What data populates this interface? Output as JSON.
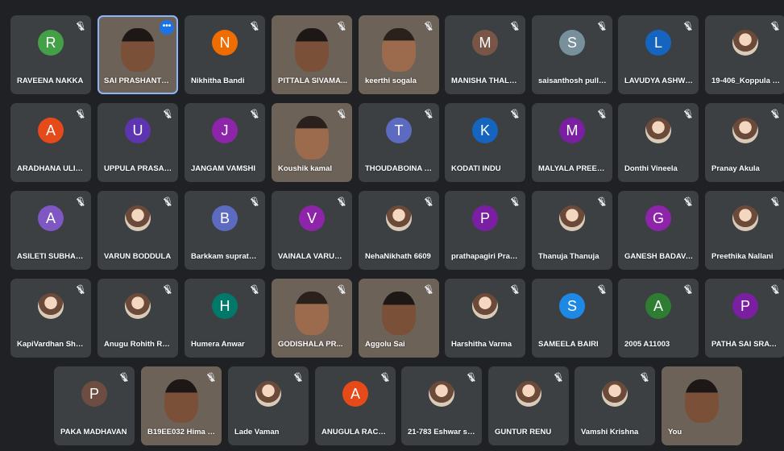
{
  "participants": [
    {
      "name": "RAVEENA NAKKA",
      "avatar": "letter",
      "initial": "R",
      "color": "#43a047",
      "muted": true
    },
    {
      "name": "SAI PRASHANTH ...",
      "avatar": "video",
      "video": "vid-a",
      "muted": false,
      "active": true
    },
    {
      "name": "Nikhitha Bandi",
      "avatar": "letter",
      "initial": "N",
      "color": "#ef6c00",
      "muted": true
    },
    {
      "name": "PITTALA SIVAMA...",
      "avatar": "video",
      "video": "vid-b",
      "muted": true
    },
    {
      "name": "keerthi sogala",
      "avatar": "video",
      "video": "vid-c",
      "muted": true
    },
    {
      "name": "MANISHA THALLA...",
      "avatar": "letter",
      "initial": "M",
      "color": "#795548",
      "muted": true
    },
    {
      "name": "saisanthosh pulluri",
      "avatar": "letter",
      "initial": "S",
      "color": "#78909c",
      "muted": true
    },
    {
      "name": "LAVUDYA ASHWINI",
      "avatar": "letter",
      "initial": "L",
      "color": "#1565c0",
      "muted": true
    },
    {
      "name": "19-406_Koppula S...",
      "avatar": "photo",
      "muted": true
    },
    {
      "name": "ARADHANA ULIRA...",
      "avatar": "letter",
      "initial": "A",
      "color": "#e64a19",
      "muted": true
    },
    {
      "name": "UPPULA PRASAN...",
      "avatar": "letter",
      "initial": "U",
      "color": "#5e35b1",
      "muted": true
    },
    {
      "name": "JANGAM VAMSHI",
      "avatar": "letter",
      "initial": "J",
      "color": "#8e24aa",
      "muted": true
    },
    {
      "name": "Koushik kamal",
      "avatar": "video",
      "video": "vid-d",
      "muted": true
    },
    {
      "name": "THOUDABOINA S...",
      "avatar": "letter",
      "initial": "T",
      "color": "#5c6bc0",
      "muted": true
    },
    {
      "name": "KODATI INDU",
      "avatar": "letter",
      "initial": "K",
      "color": "#1565c0",
      "muted": true
    },
    {
      "name": "MALYALA PREETH...",
      "avatar": "letter",
      "initial": "M",
      "color": "#7b1fa2",
      "muted": true
    },
    {
      "name": "Donthi Vineela",
      "avatar": "photo",
      "muted": true
    },
    {
      "name": "Pranay Akula",
      "avatar": "photo",
      "muted": true
    },
    {
      "name": "ASILETI SUBHASH",
      "avatar": "letter",
      "initial": "A",
      "color": "#7e57c2",
      "muted": true
    },
    {
      "name": "VARUN BODDULA",
      "avatar": "photo",
      "muted": true
    },
    {
      "name": "Barkkam suprathika",
      "avatar": "letter",
      "initial": "B",
      "color": "#5c6bc0",
      "muted": true
    },
    {
      "name": "VAINALA VARUN T...",
      "avatar": "letter",
      "initial": "V",
      "color": "#8e24aa",
      "muted": true
    },
    {
      "name": "NehaNikhath 6609",
      "avatar": "photo",
      "muted": true
    },
    {
      "name": "prathapagiri Prag...",
      "avatar": "letter",
      "initial": "P",
      "color": "#7b1fa2",
      "muted": true
    },
    {
      "name": "Thanuja Thanuja",
      "avatar": "photo",
      "muted": true
    },
    {
      "name": "GANESH BADAVA...",
      "avatar": "letter",
      "initial": "G",
      "color": "#8e24aa",
      "muted": true
    },
    {
      "name": "Preethika Nallani",
      "avatar": "photo",
      "muted": true
    },
    {
      "name": "KapiVardhan Shar...",
      "avatar": "photo",
      "muted": true
    },
    {
      "name": "Anugu Rohith Red...",
      "avatar": "photo",
      "muted": true
    },
    {
      "name": "Humera Anwar",
      "avatar": "letter",
      "initial": "H",
      "color": "#00796b",
      "muted": true
    },
    {
      "name": "GODISHALA PR...",
      "avatar": "video",
      "video": "vid-e",
      "muted": true
    },
    {
      "name": "Aggolu Sai",
      "avatar": "video",
      "video": "vid-f",
      "muted": true
    },
    {
      "name": "Harshitha Varma",
      "avatar": "photo",
      "muted": true
    },
    {
      "name": "SAMEELA BAIRI",
      "avatar": "letter",
      "initial": "S",
      "color": "#1e88e5",
      "muted": true
    },
    {
      "name": "2005 A11003",
      "avatar": "letter",
      "initial": "A",
      "color": "#2e7d32",
      "muted": true
    },
    {
      "name": "PATHA SAI SRAVAN",
      "avatar": "letter",
      "initial": "P",
      "color": "#7b1fa2",
      "muted": true
    },
    {
      "name": "PAKA MADHAVAN",
      "avatar": "letter",
      "initial": "P",
      "color": "#6d4c41",
      "muted": true
    },
    {
      "name": "B19EE032 Hima v...",
      "avatar": "video",
      "video": "vid-g",
      "muted": true
    },
    {
      "name": "Lade Vaman",
      "avatar": "photo",
      "muted": true
    },
    {
      "name": "ANUGULA RACHA...",
      "avatar": "letter",
      "initial": "A",
      "color": "#e64a19",
      "muted": true
    },
    {
      "name": "21-783 Eshwar sai.k",
      "avatar": "photo",
      "muted": true
    },
    {
      "name": "GUNTUR RENU",
      "avatar": "photo",
      "muted": true
    },
    {
      "name": "Vamshi Krishna",
      "avatar": "photo",
      "muted": true
    },
    {
      "name": "You",
      "avatar": "video",
      "video": "vid-h",
      "muted": false
    }
  ],
  "icons": {
    "mic_off": "mic-off-icon",
    "more": "more-options-icon"
  },
  "more_label": "•••",
  "accent": "#8ab4f8"
}
